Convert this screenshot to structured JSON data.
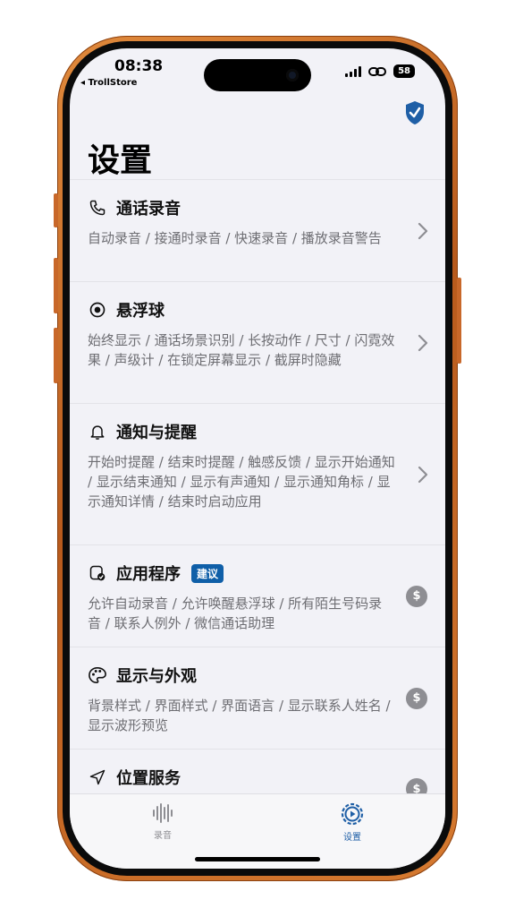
{
  "status_bar": {
    "time": "08:38",
    "back_app": "◂ TrollStore",
    "battery": "58"
  },
  "page": {
    "title": "设置"
  },
  "settings": [
    {
      "icon": "phone-icon",
      "title": "通话录音",
      "desc": "自动录音 / 接通时录音 / 快速录音 / 播放录音警告",
      "accessory": "chevron"
    },
    {
      "icon": "record-dot-icon",
      "title": "悬浮球",
      "desc": "始终显示 / 通话场景识别 / 长按动作 / 尺寸 / 闪霓效果 / 声级计 / 在锁定屏幕显示 / 截屏时隐藏",
      "accessory": "chevron"
    },
    {
      "icon": "bell-icon",
      "title": "通知与提醒",
      "desc": "开始时提醒 / 结束时提醒 / 触感反馈 / 显示开始通知 / 显示结束通知 / 显示有声通知 / 显示通知角标 / 显示通知详情 / 结束时启动应用",
      "accessory": "chevron"
    },
    {
      "icon": "app-check-icon",
      "title": "应用程序",
      "badge": "建议",
      "desc": "允许自动录音 / 允许唤醒悬浮球 / 所有陌生号码录音 / 联系人例外 / 微信通话助理",
      "accessory": "coin"
    },
    {
      "icon": "palette-icon",
      "title": "显示与外观",
      "desc": "背景样式 / 界面样式 / 界面语言 / 显示联系人姓名 / 显示波形预览",
      "accessory": "coin"
    },
    {
      "icon": "location-arrow-icon",
      "title": "位置服务",
      "desc": "",
      "accessory": "coin"
    }
  ],
  "coin_symbol": "$",
  "tabbar": {
    "tab_record": "录音",
    "tab_settings": "设置",
    "accent": "#1f5fa6"
  }
}
